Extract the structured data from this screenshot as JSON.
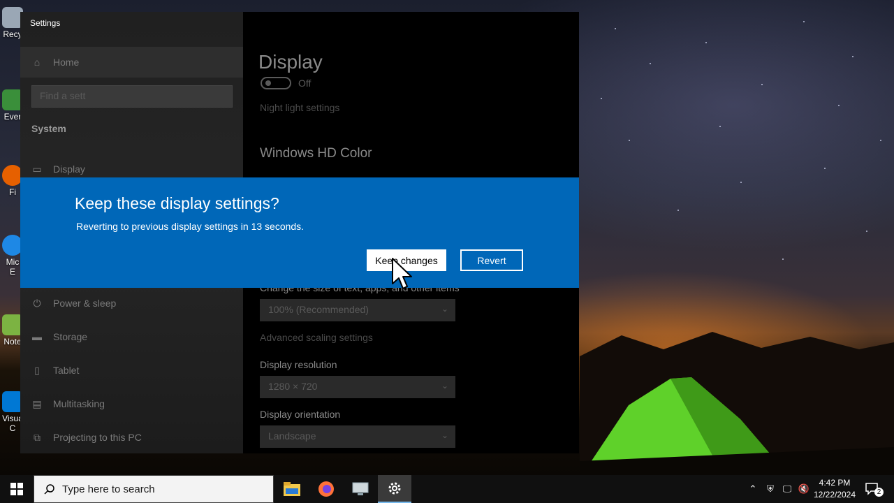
{
  "desktop": {
    "icons": [
      {
        "label": "Recy",
        "color": "#9aa7b5"
      },
      {
        "label": "Ever",
        "color": "#3a8f3a"
      },
      {
        "label": "Fi",
        "color": "#e66000"
      },
      {
        "label": "Mic",
        "color": "#1e88e5"
      },
      {
        "label": "E",
        "color": ""
      },
      {
        "label": "Note",
        "color": "#7cb342"
      },
      {
        "label": "Visua",
        "color": "#0078d4"
      },
      {
        "label": "C",
        "color": ""
      }
    ]
  },
  "settings": {
    "window_title": "Settings",
    "nav": {
      "home": "Home",
      "search_placeholder": "Find a sett",
      "section": "System",
      "items": [
        "Display",
        "Power & sleep",
        "Storage",
        "Tablet",
        "Multitasking",
        "Projecting to this PC"
      ]
    },
    "content": {
      "page_title": "Display",
      "toggle_label": "Off",
      "night_light_link": "Night light settings",
      "hd_color_heading": "Windows HD Color",
      "scale_label": "Change the size of text, apps, and other items",
      "scale_value": "100% (Recommended)",
      "advanced_scaling_link": "Advanced scaling settings",
      "resolution_label": "Display resolution",
      "resolution_value": "1280 × 720",
      "orientation_label": "Display orientation",
      "orientation_value": "Landscape"
    }
  },
  "dialog": {
    "title": "Keep these display settings?",
    "message": "Reverting to previous display settings in 13 seconds.",
    "keep_label": "Keep changes",
    "revert_label": "Revert",
    "accent": "#0067b8"
  },
  "taskbar": {
    "search_placeholder": "Type here to search",
    "apps": [
      "file-explorer-icon",
      "firefox-icon",
      "remote-desktop-icon",
      "settings-icon"
    ],
    "time": "4:42 PM",
    "date": "12/22/2024",
    "notification_count": "2"
  }
}
